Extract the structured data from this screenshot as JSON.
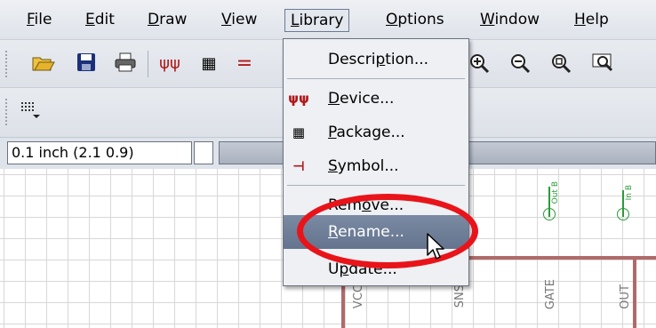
{
  "menubar": {
    "items": [
      {
        "pre": "",
        "u": "F",
        "post": "ile"
      },
      {
        "pre": "",
        "u": "E",
        "post": "dit"
      },
      {
        "pre": "",
        "u": "D",
        "post": "raw"
      },
      {
        "pre": "",
        "u": "V",
        "post": "iew"
      },
      {
        "pre": "",
        "u": "L",
        "post": "ibrary"
      },
      {
        "pre": "",
        "u": "O",
        "post": "ptions"
      },
      {
        "pre": "",
        "u": "W",
        "post": "indow"
      },
      {
        "pre": "",
        "u": "H",
        "post": "elp"
      }
    ]
  },
  "status": {
    "coordinate": "0.1 inch (2.1 0.9)"
  },
  "library_menu": {
    "items": [
      {
        "pre": "Descri",
        "u": "p",
        "post": "tion...",
        "icon": ""
      },
      {
        "pre": "",
        "u": "D",
        "post": "evice...",
        "icon": "device-icon"
      },
      {
        "pre": "",
        "u": "P",
        "post": "ackage...",
        "icon": "package-icon"
      },
      {
        "pre": "",
        "u": "S",
        "post": "ymbol...",
        "icon": "symbol-icon"
      },
      {
        "pre": "Rem",
        "u": "o",
        "post": "ve...",
        "icon": ""
      },
      {
        "pre": "",
        "u": "R",
        "post": "ename...",
        "icon": ""
      },
      {
        "pre": "U",
        "u": "p",
        "post": "date...",
        "icon": ""
      }
    ],
    "highlighted_index": 5
  },
  "canvas": {
    "pin_labels": [
      "VCC",
      "SNS",
      "GATE",
      "OUT"
    ],
    "pin_names": [
      "Out B",
      "In B"
    ]
  },
  "colors": {
    "annotation": "#e8141a",
    "highlight": "#6f7e98",
    "wire": "#b06a6a",
    "pin": "#2c9a3a"
  }
}
